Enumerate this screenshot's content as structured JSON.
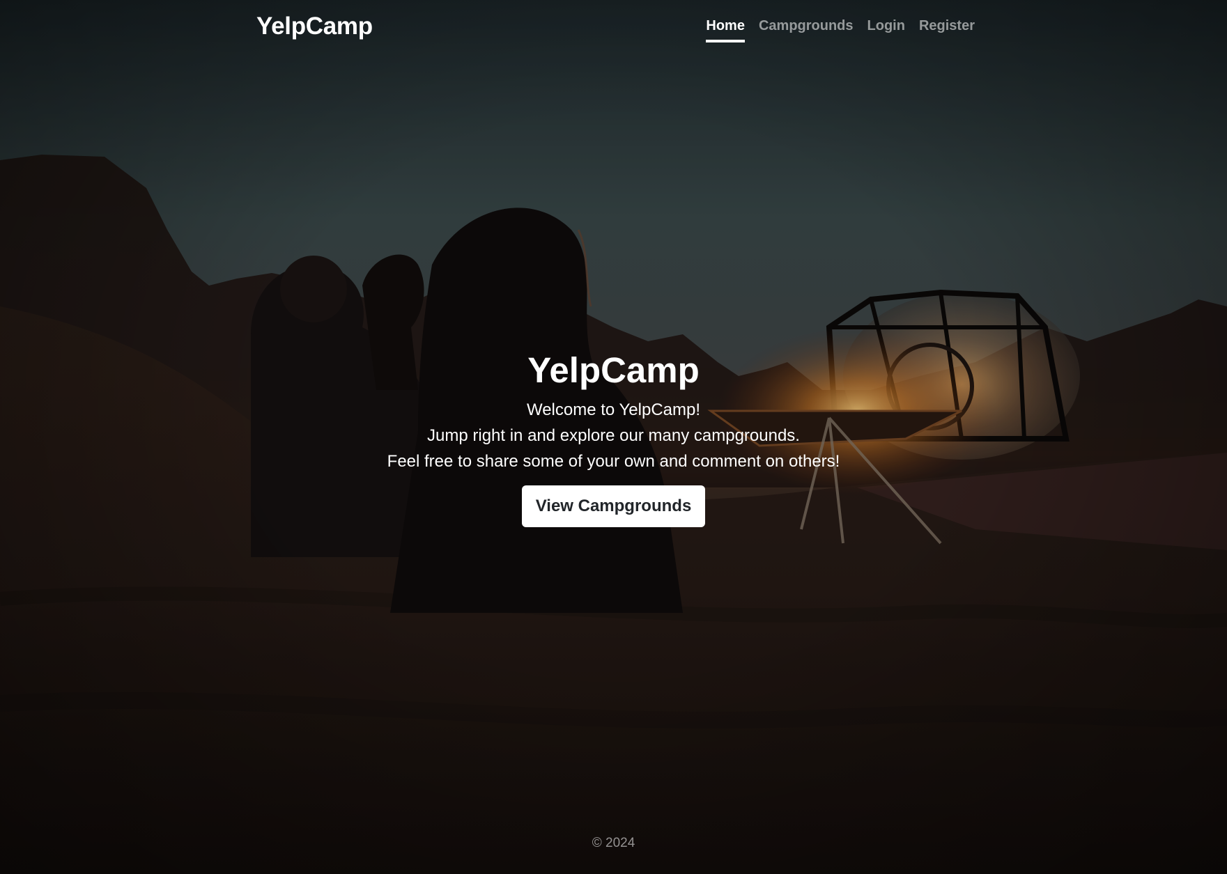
{
  "navbar": {
    "brand": "YelpCamp",
    "links": [
      {
        "label": "Home",
        "active": true
      },
      {
        "label": "Campgrounds",
        "active": false
      },
      {
        "label": "Login",
        "active": false
      },
      {
        "label": "Register",
        "active": false
      }
    ]
  },
  "hero": {
    "title": "YelpCamp",
    "lines": [
      "Welcome to YelpCamp!",
      "Jump right in and explore our many campgrounds.",
      "Feel free to share some of your own and comment on others!"
    ],
    "button_label": "View Campgrounds"
  },
  "footer": {
    "copyright": "© 2024"
  },
  "colors": {
    "sky_top": "#2c3a3f",
    "sky_horizon": "#a0582a",
    "sand": "#2a1d18",
    "fire": "#f0a040"
  }
}
